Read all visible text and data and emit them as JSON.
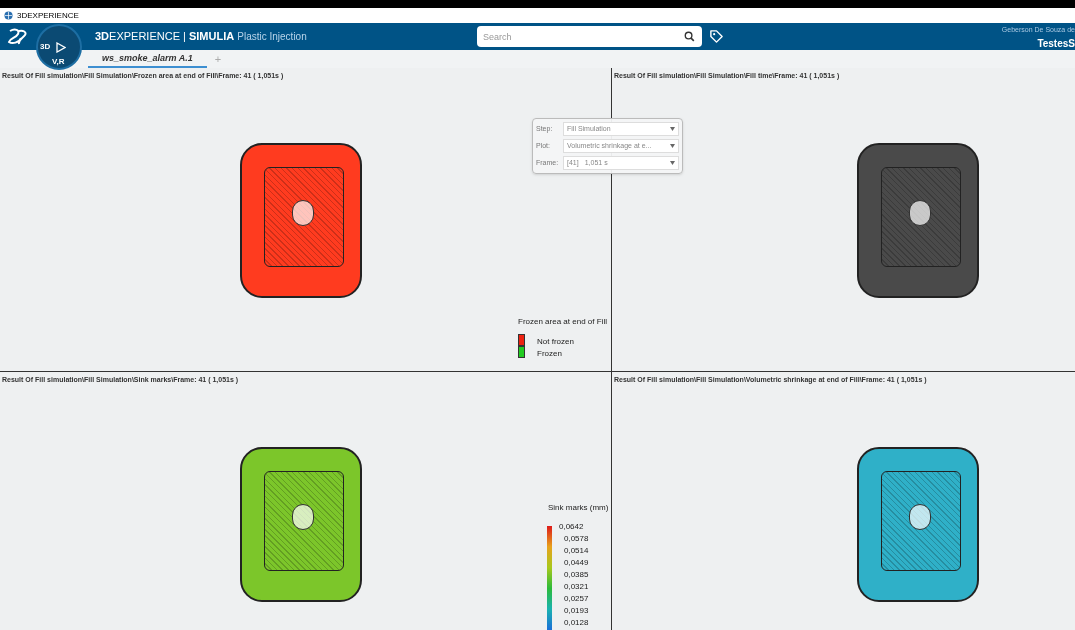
{
  "window": {
    "title": "3DEXPERIENCE"
  },
  "header": {
    "brand_bold": "3D",
    "brand_rest": "EXPERIENCE | ",
    "brand_app": "SIMULIA",
    "brand_role": "Plastic Injection",
    "compass": {
      "left": "3D",
      "bottom": "V,R"
    },
    "search": {
      "placeholder": "Search"
    },
    "user": "Geberson De Souza de",
    "tenant": "TestesS"
  },
  "tabs": [
    {
      "label": "ws_smoke_alarm A.1",
      "selected": true
    }
  ],
  "add_tab": "+",
  "viewports": [
    {
      "title": "Result Of Fill simulation\\Fill Simulation\\Frozen area at end of Fill\\Frame: 41 ( 1,051s )",
      "color": "#ff3b1f"
    },
    {
      "title": "Result Of Fill simulation\\Fill Simulation\\Fill time\\Frame: 41 ( 1,051s )",
      "color": "#4a4a4a"
    },
    {
      "title": "Result Of Fill simulation\\Fill Simulation\\Sink marks\\Frame: 41 ( 1,051s )",
      "color": "#7cc62a"
    },
    {
      "title": "Result Of Fill simulation\\Fill Simulation\\Volumetric shrinkage at end of Fill\\Frame: 41 ( 1,051s )",
      "color": "#2fb0c8"
    }
  ],
  "result_panel": {
    "rows": [
      {
        "label": "Step:",
        "value": "Fill Simulation"
      },
      {
        "label": "Plot:",
        "value": "Volumetric shrinkage at e..."
      },
      {
        "label": "Frame:",
        "value": "[41]",
        "value_2": "1,051 s"
      }
    ]
  },
  "frozen_legend": {
    "title": "Frozen area at end of Fill",
    "items": [
      {
        "label": "Not frozen",
        "color": "#ee2211"
      },
      {
        "label": "Frozen",
        "color": "#22cc22"
      }
    ]
  },
  "sink_legend": {
    "title": "Sink marks (mm)",
    "ticks": [
      "0,0642",
      "0,0578",
      "0,0514",
      "0,0449",
      "0,0385",
      "0,0321",
      "0,0257",
      "0,0193",
      "0,0128"
    ]
  }
}
